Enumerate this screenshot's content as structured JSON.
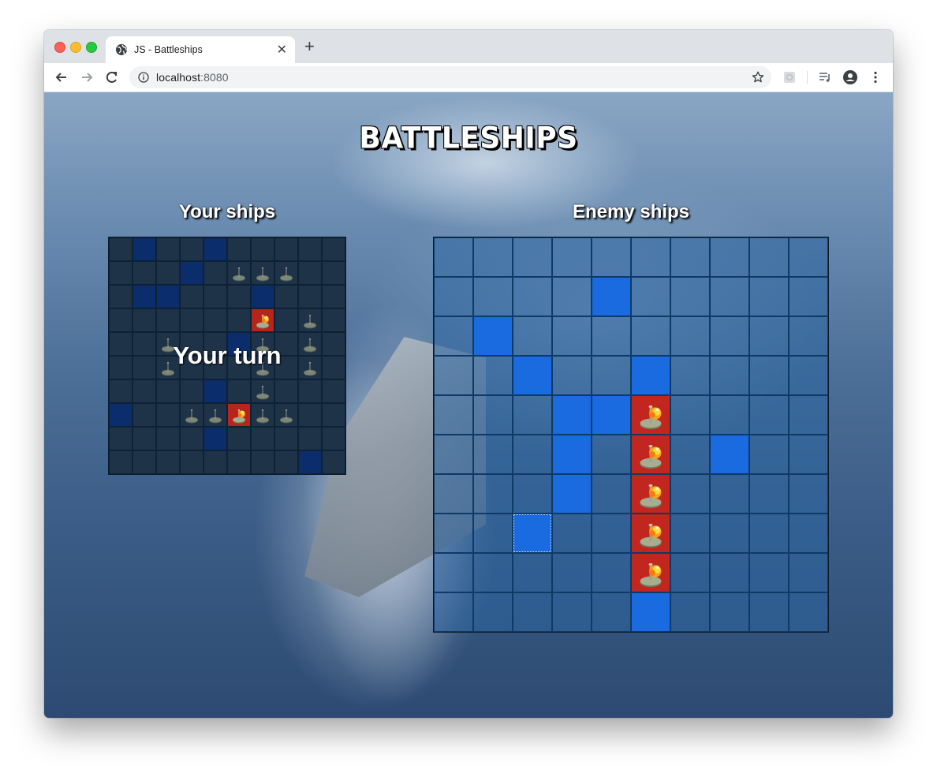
{
  "browser": {
    "tab_title": "JS - Battleships",
    "new_tab_label": "+",
    "close_label": "✕",
    "url_host": "localhost",
    "url_port": ":8080"
  },
  "page": {
    "title": "BATTLESHIPS",
    "player_heading": "Your ships",
    "enemy_heading": "Enemy ships",
    "turn_message": "Your turn"
  },
  "legend_colors": {
    "player_water": "#1e3248",
    "player_ship": "#0c2d6b",
    "enemy_water": "#2c64a0",
    "miss": "#1a6ae0",
    "hit": "#c1271e"
  },
  "player_board": [
    [
      "w",
      "s",
      "w",
      "w",
      "s",
      "w",
      "w",
      "w",
      "w",
      "w"
    ],
    [
      "w",
      "w",
      "w",
      "s",
      "w",
      "m",
      "m",
      "m",
      "w",
      "w"
    ],
    [
      "w",
      "s",
      "s",
      "w",
      "w",
      "w",
      "s",
      "w",
      "w",
      "w"
    ],
    [
      "w",
      "w",
      "w",
      "w",
      "w",
      "w",
      "h",
      "w",
      "m",
      "w"
    ],
    [
      "w",
      "w",
      "m",
      "w",
      "w",
      "s",
      "m",
      "w",
      "m",
      "w"
    ],
    [
      "w",
      "w",
      "m",
      "w",
      "w",
      "w",
      "m",
      "w",
      "m",
      "w"
    ],
    [
      "w",
      "w",
      "w",
      "w",
      "s",
      "w",
      "m",
      "w",
      "w",
      "w"
    ],
    [
      "s",
      "w",
      "w",
      "m",
      "m",
      "h",
      "m",
      "m",
      "w",
      "w"
    ],
    [
      "w",
      "w",
      "w",
      "w",
      "s",
      "w",
      "w",
      "w",
      "w",
      "w"
    ],
    [
      "w",
      "w",
      "w",
      "w",
      "w",
      "w",
      "w",
      "w",
      "s",
      "w"
    ]
  ],
  "enemy_board": [
    [
      "w",
      "w",
      "w",
      "w",
      "w",
      "w",
      "w",
      "w",
      "w",
      "w"
    ],
    [
      "w",
      "w",
      "w",
      "w",
      "x",
      "w",
      "w",
      "w",
      "w",
      "w"
    ],
    [
      "w",
      "x",
      "w",
      "w",
      "w",
      "w",
      "w",
      "w",
      "w",
      "w"
    ],
    [
      "w",
      "w",
      "x",
      "w",
      "w",
      "x",
      "w",
      "w",
      "w",
      "w"
    ],
    [
      "w",
      "w",
      "w",
      "x",
      "x",
      "h",
      "w",
      "w",
      "w",
      "w"
    ],
    [
      "w",
      "w",
      "w",
      "x",
      "w",
      "h",
      "w",
      "x",
      "w",
      "w"
    ],
    [
      "w",
      "w",
      "w",
      "x",
      "w",
      "h",
      "w",
      "w",
      "w",
      "w"
    ],
    [
      "w",
      "w",
      "v",
      "w",
      "w",
      "h",
      "w",
      "w",
      "w",
      "w"
    ],
    [
      "w",
      "w",
      "w",
      "w",
      "w",
      "h",
      "w",
      "w",
      "w",
      "w"
    ],
    [
      "w",
      "w",
      "w",
      "w",
      "w",
      "x",
      "w",
      "w",
      "w",
      "w"
    ]
  ]
}
